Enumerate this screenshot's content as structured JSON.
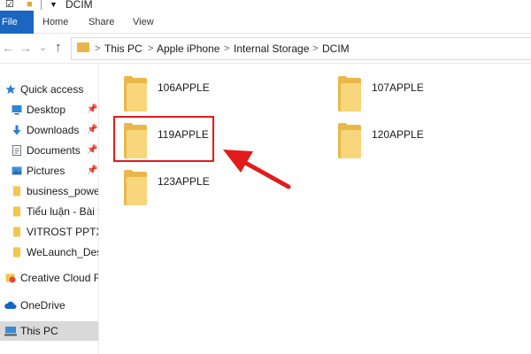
{
  "window": {
    "title": "DCIM"
  },
  "ribbon": {
    "tabs": [
      "File",
      "Home",
      "Share",
      "View"
    ]
  },
  "address": {
    "crumbs": [
      "This PC",
      "Apple iPhone",
      "Internal Storage",
      "DCIM"
    ],
    "separator": ">"
  },
  "nav": {
    "back_glyph": "←",
    "forward_glyph": "→",
    "recent_glyph": "⌄",
    "up_glyph": "↑",
    "items": [
      {
        "label": "Quick access",
        "icon": "star-icon",
        "pinned": false
      },
      {
        "label": "Desktop",
        "icon": "desktop-icon",
        "pinned": true
      },
      {
        "label": "Downloads",
        "icon": "download-icon",
        "pinned": true
      },
      {
        "label": "Documents",
        "icon": "documents-icon",
        "pinned": true
      },
      {
        "label": "Pictures",
        "icon": "pictures-icon",
        "pinned": true
      },
      {
        "label": "business_power",
        "icon": "folder-icon",
        "pinned": false
      },
      {
        "label": "Tiểu luận - Bài th",
        "icon": "folder-icon",
        "pinned": false
      },
      {
        "label": "VITROST PPTX",
        "icon": "folder-icon",
        "pinned": false
      },
      {
        "label": "WeLaunch_Desig",
        "icon": "folder-icon",
        "pinned": false
      },
      {
        "label": "Creative Cloud File",
        "icon": "creative-cloud-icon",
        "pinned": false
      },
      {
        "label": "OneDrive",
        "icon": "cloud-icon",
        "pinned": false
      },
      {
        "label": "This PC",
        "icon": "computer-icon",
        "pinned": false,
        "selected": true
      }
    ]
  },
  "folders": [
    "106APPLE",
    "107APPLE",
    "119APPLE",
    "120APPLE",
    "123APPLE"
  ],
  "colors": {
    "file_tab": "#1a66c0",
    "highlight": "#e21b1b",
    "folder": "#f7d67c",
    "folder_back": "#e9b84a"
  }
}
